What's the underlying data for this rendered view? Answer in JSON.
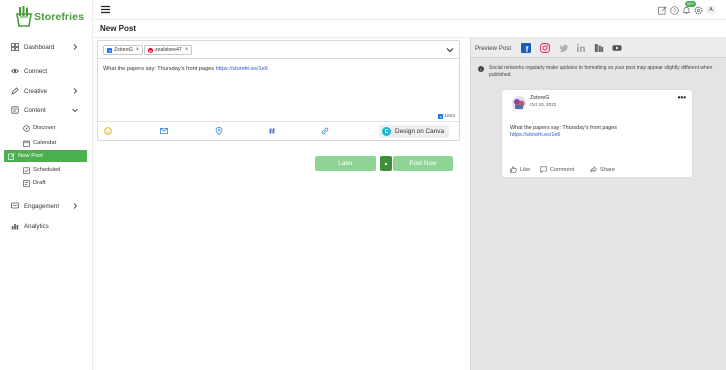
{
  "brand": {
    "name": "Storefries",
    "color": "#4a9a3a"
  },
  "sidebar": {
    "items": [
      {
        "label": "Dashboard",
        "icon": "grid-icon"
      },
      {
        "label": "Connect",
        "icon": "eye-icon"
      },
      {
        "label": "Creative",
        "icon": "pen-icon"
      },
      {
        "label": "Content",
        "icon": "content-icon"
      },
      {
        "label": "Engagement",
        "icon": "engagement-icon"
      },
      {
        "label": "Analytics",
        "icon": "chart-icon"
      }
    ],
    "content_sub": [
      {
        "label": "Discover",
        "icon": "compass-icon"
      },
      {
        "label": "Calendar",
        "icon": "calendar-icon"
      },
      {
        "label": "New Post",
        "icon": "edit-icon"
      },
      {
        "label": "Scheduled",
        "icon": "scheduled-icon"
      },
      {
        "label": "Draft",
        "icon": "draft-icon"
      }
    ],
    "active": "New Post",
    "active_color": "#4caf50"
  },
  "header": {
    "notification_badge": "99+",
    "avatar_initial": "A"
  },
  "page": {
    "title": "New Post"
  },
  "composer": {
    "accounts": [
      {
        "network": "facebook",
        "name": "ZstoreG"
      },
      {
        "network": "pinterest",
        "name": "zealstore47"
      }
    ],
    "text": "What the papers say: Thursday's front pages ",
    "link": "https://storefri.es/1e6",
    "char_count": "1833",
    "canva_label": "Design on Canva"
  },
  "actions": {
    "later_label": "Later",
    "post_now_label": "Post Now"
  },
  "preview": {
    "title": "Preview Post",
    "notice": "Social networks regularly make updates to formatting so your post may appear slightly different when published.",
    "card": {
      "name": "ZstoreG",
      "date": "Oct 20, 2022",
      "text": "What the papers say: Thursday's front pages",
      "link": "https://storefri.es/1e6",
      "like_label": "Like",
      "comment_label": "Comment",
      "share_label": "Share"
    }
  }
}
